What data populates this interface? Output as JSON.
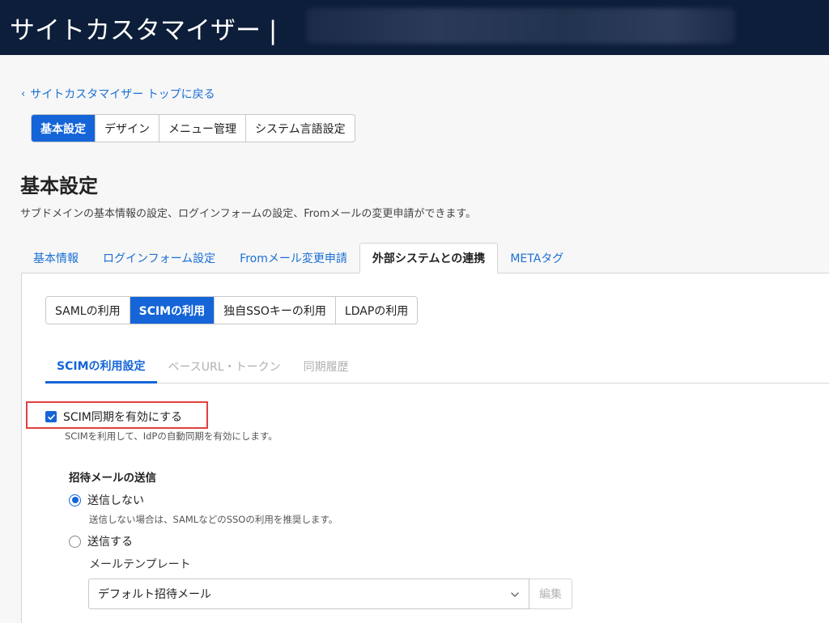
{
  "header": {
    "title": "サイトカスタマイザー |"
  },
  "back_link": {
    "label": "サイトカスタマイザー トップに戻る"
  },
  "top_tabs": [
    {
      "label": "基本設定",
      "active": true
    },
    {
      "label": "デザイン",
      "active": false
    },
    {
      "label": "メニュー管理",
      "active": false
    },
    {
      "label": "システム言語設定",
      "active": false
    }
  ],
  "page": {
    "title": "基本設定",
    "description": "サブドメインの基本情報の設定、ログインフォームの設定、Fromメールの変更申請ができます。"
  },
  "main_tabs": [
    {
      "label": "基本情報",
      "active": false
    },
    {
      "label": "ログインフォーム設定",
      "active": false
    },
    {
      "label": "Fromメール変更申請",
      "active": false
    },
    {
      "label": "外部システムとの連携",
      "active": true
    },
    {
      "label": "METAタグ",
      "active": false
    }
  ],
  "integration_tabs": [
    {
      "label": "SAMLの利用",
      "active": false
    },
    {
      "label": "SCIMの利用",
      "active": true
    },
    {
      "label": "独自SSOキーの利用",
      "active": false
    },
    {
      "label": "LDAPの利用",
      "active": false
    }
  ],
  "scim_tabs": [
    {
      "label": "SCIMの利用設定",
      "active": true
    },
    {
      "label": "ベースURL・トークン",
      "active": false
    },
    {
      "label": "同期履歴",
      "active": false
    }
  ],
  "scim_sync": {
    "label": "SCIM同期を有効にする",
    "checked": true,
    "help": "SCIMを利用して、IdPの自動同期を有効にします。"
  },
  "invite_mail": {
    "title": "招待メールの送信",
    "options": [
      {
        "label": "送信しない",
        "checked": true,
        "help": "送信しない場合は、SAMLなどのSSOの利用を推奨します。"
      },
      {
        "label": "送信する",
        "checked": false
      }
    ],
    "template_label": "メールテンプレート",
    "template_value": "デフォルト招待メール",
    "edit_label": "編集"
  },
  "colors": {
    "header_bg": "#0d1e3a",
    "accent": "#1565d8",
    "link": "#1a6fd4",
    "highlight": "#e0413f"
  }
}
